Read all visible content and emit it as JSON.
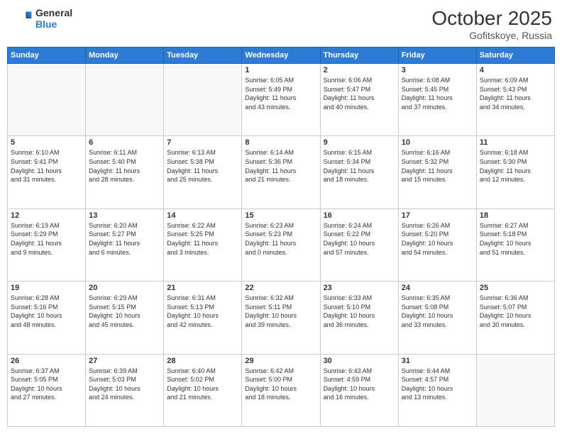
{
  "logo": {
    "line1": "General",
    "line2": "Blue"
  },
  "header": {
    "month": "October 2025",
    "location": "Gofitskoye, Russia"
  },
  "weekdays": [
    "Sunday",
    "Monday",
    "Tuesday",
    "Wednesday",
    "Thursday",
    "Friday",
    "Saturday"
  ],
  "weeks": [
    [
      {
        "day": "",
        "info": ""
      },
      {
        "day": "",
        "info": ""
      },
      {
        "day": "",
        "info": ""
      },
      {
        "day": "1",
        "info": "Sunrise: 6:05 AM\nSunset: 5:49 PM\nDaylight: 11 hours\nand 43 minutes."
      },
      {
        "day": "2",
        "info": "Sunrise: 6:06 AM\nSunset: 5:47 PM\nDaylight: 11 hours\nand 40 minutes."
      },
      {
        "day": "3",
        "info": "Sunrise: 6:08 AM\nSunset: 5:45 PM\nDaylight: 11 hours\nand 37 minutes."
      },
      {
        "day": "4",
        "info": "Sunrise: 6:09 AM\nSunset: 5:43 PM\nDaylight: 11 hours\nand 34 minutes."
      }
    ],
    [
      {
        "day": "5",
        "info": "Sunrise: 6:10 AM\nSunset: 5:41 PM\nDaylight: 11 hours\nand 31 minutes."
      },
      {
        "day": "6",
        "info": "Sunrise: 6:11 AM\nSunset: 5:40 PM\nDaylight: 11 hours\nand 28 minutes."
      },
      {
        "day": "7",
        "info": "Sunrise: 6:13 AM\nSunset: 5:38 PM\nDaylight: 11 hours\nand 25 minutes."
      },
      {
        "day": "8",
        "info": "Sunrise: 6:14 AM\nSunset: 5:36 PM\nDaylight: 11 hours\nand 21 minutes."
      },
      {
        "day": "9",
        "info": "Sunrise: 6:15 AM\nSunset: 5:34 PM\nDaylight: 11 hours\nand 18 minutes."
      },
      {
        "day": "10",
        "info": "Sunrise: 6:16 AM\nSunset: 5:32 PM\nDaylight: 11 hours\nand 15 minutes."
      },
      {
        "day": "11",
        "info": "Sunrise: 6:18 AM\nSunset: 5:30 PM\nDaylight: 11 hours\nand 12 minutes."
      }
    ],
    [
      {
        "day": "12",
        "info": "Sunrise: 6:19 AM\nSunset: 5:29 PM\nDaylight: 11 hours\nand 9 minutes."
      },
      {
        "day": "13",
        "info": "Sunrise: 6:20 AM\nSunset: 5:27 PM\nDaylight: 11 hours\nand 6 minutes."
      },
      {
        "day": "14",
        "info": "Sunrise: 6:22 AM\nSunset: 5:25 PM\nDaylight: 11 hours\nand 3 minutes."
      },
      {
        "day": "15",
        "info": "Sunrise: 6:23 AM\nSunset: 5:23 PM\nDaylight: 11 hours\nand 0 minutes."
      },
      {
        "day": "16",
        "info": "Sunrise: 6:24 AM\nSunset: 5:22 PM\nDaylight: 10 hours\nand 57 minutes."
      },
      {
        "day": "17",
        "info": "Sunrise: 6:26 AM\nSunset: 5:20 PM\nDaylight: 10 hours\nand 54 minutes."
      },
      {
        "day": "18",
        "info": "Sunrise: 6:27 AM\nSunset: 5:18 PM\nDaylight: 10 hours\nand 51 minutes."
      }
    ],
    [
      {
        "day": "19",
        "info": "Sunrise: 6:28 AM\nSunset: 5:16 PM\nDaylight: 10 hours\nand 48 minutes."
      },
      {
        "day": "20",
        "info": "Sunrise: 6:29 AM\nSunset: 5:15 PM\nDaylight: 10 hours\nand 45 minutes."
      },
      {
        "day": "21",
        "info": "Sunrise: 6:31 AM\nSunset: 5:13 PM\nDaylight: 10 hours\nand 42 minutes."
      },
      {
        "day": "22",
        "info": "Sunrise: 6:32 AM\nSunset: 5:11 PM\nDaylight: 10 hours\nand 39 minutes."
      },
      {
        "day": "23",
        "info": "Sunrise: 6:33 AM\nSunset: 5:10 PM\nDaylight: 10 hours\nand 36 minutes."
      },
      {
        "day": "24",
        "info": "Sunrise: 6:35 AM\nSunset: 5:08 PM\nDaylight: 10 hours\nand 33 minutes."
      },
      {
        "day": "25",
        "info": "Sunrise: 6:36 AM\nSunset: 5:07 PM\nDaylight: 10 hours\nand 30 minutes."
      }
    ],
    [
      {
        "day": "26",
        "info": "Sunrise: 6:37 AM\nSunset: 5:05 PM\nDaylight: 10 hours\nand 27 minutes."
      },
      {
        "day": "27",
        "info": "Sunrise: 6:39 AM\nSunset: 5:03 PM\nDaylight: 10 hours\nand 24 minutes."
      },
      {
        "day": "28",
        "info": "Sunrise: 6:40 AM\nSunset: 5:02 PM\nDaylight: 10 hours\nand 21 minutes."
      },
      {
        "day": "29",
        "info": "Sunrise: 6:42 AM\nSunset: 5:00 PM\nDaylight: 10 hours\nand 18 minutes."
      },
      {
        "day": "30",
        "info": "Sunrise: 6:43 AM\nSunset: 4:59 PM\nDaylight: 10 hours\nand 16 minutes."
      },
      {
        "day": "31",
        "info": "Sunrise: 6:44 AM\nSunset: 4:57 PM\nDaylight: 10 hours\nand 13 minutes."
      },
      {
        "day": "",
        "info": ""
      }
    ]
  ]
}
